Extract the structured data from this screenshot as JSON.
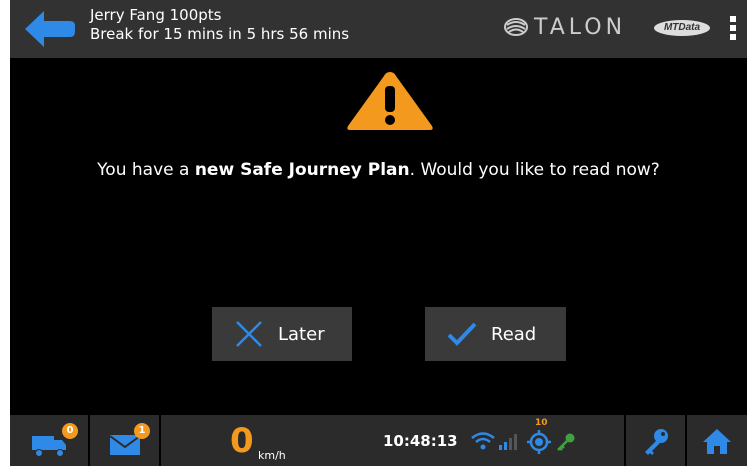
{
  "header": {
    "user_line": "Jerry Fang 100pts",
    "break_line": "Break for 15 mins in 5 hrs 56 mins",
    "brand": "TALON",
    "sub_brand": "MTData"
  },
  "dialog": {
    "message_prefix": "You have a ",
    "message_bold": "new Safe Journey Plan",
    "message_suffix": ". Would you like to read now?",
    "later_label": "Later",
    "read_label": "Read"
  },
  "statusbar": {
    "jobs_count": "0",
    "messages_count": "1",
    "speed": "0",
    "speed_unit": "km/h",
    "time": "10:48:13",
    "gps_satellites": "10"
  },
  "colors": {
    "accent_blue": "#2e8ae6",
    "warning_orange": "#f39a1e",
    "background": "#000000",
    "header_bg": "#323232"
  },
  "icons": [
    "back-arrow-icon",
    "talon-logo-icon",
    "more-menu-icon",
    "warning-icon",
    "close-x-icon",
    "checkmark-icon",
    "truck-icon",
    "mail-icon",
    "wifi-icon",
    "signal-icon",
    "gps-icon",
    "key-icon",
    "home-icon"
  ]
}
